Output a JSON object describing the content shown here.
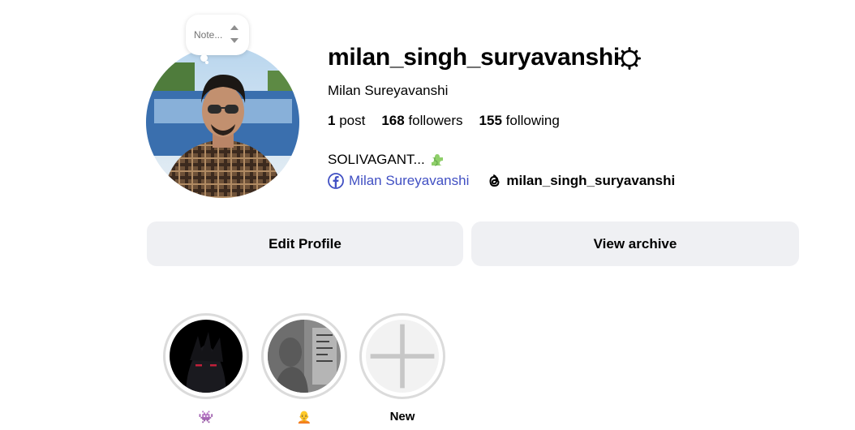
{
  "note": {
    "placeholder": "Note..."
  },
  "profile": {
    "username": "milan_singh_suryavanshi",
    "full_name": "Milan Sureyavanshi",
    "bio": "SOLIVAGANT...",
    "bio_emoji": "puzzle-piece",
    "stats": {
      "posts_count": "1",
      "posts_label": "post",
      "followers_count": "168",
      "followers_label": "followers",
      "following_count": "155",
      "following_label": "following"
    },
    "links": {
      "facebook": "Milan Sureyavanshi",
      "threads": "milan_singh_suryavanshi"
    }
  },
  "buttons": {
    "edit_profile": "Edit Profile",
    "view_archive": "View archive"
  },
  "highlights": [
    {
      "label": "👾",
      "icon": "dark-character-thumbnail"
    },
    {
      "label": "🧑‍🦲",
      "icon": "grey-photo-thumbnail"
    },
    {
      "label": "New",
      "icon": "plus-icon"
    }
  ],
  "colors": {
    "button_bg": "#eff0f3",
    "link_blue": "#4150c3",
    "ring_grey": "#dbdbdb"
  }
}
